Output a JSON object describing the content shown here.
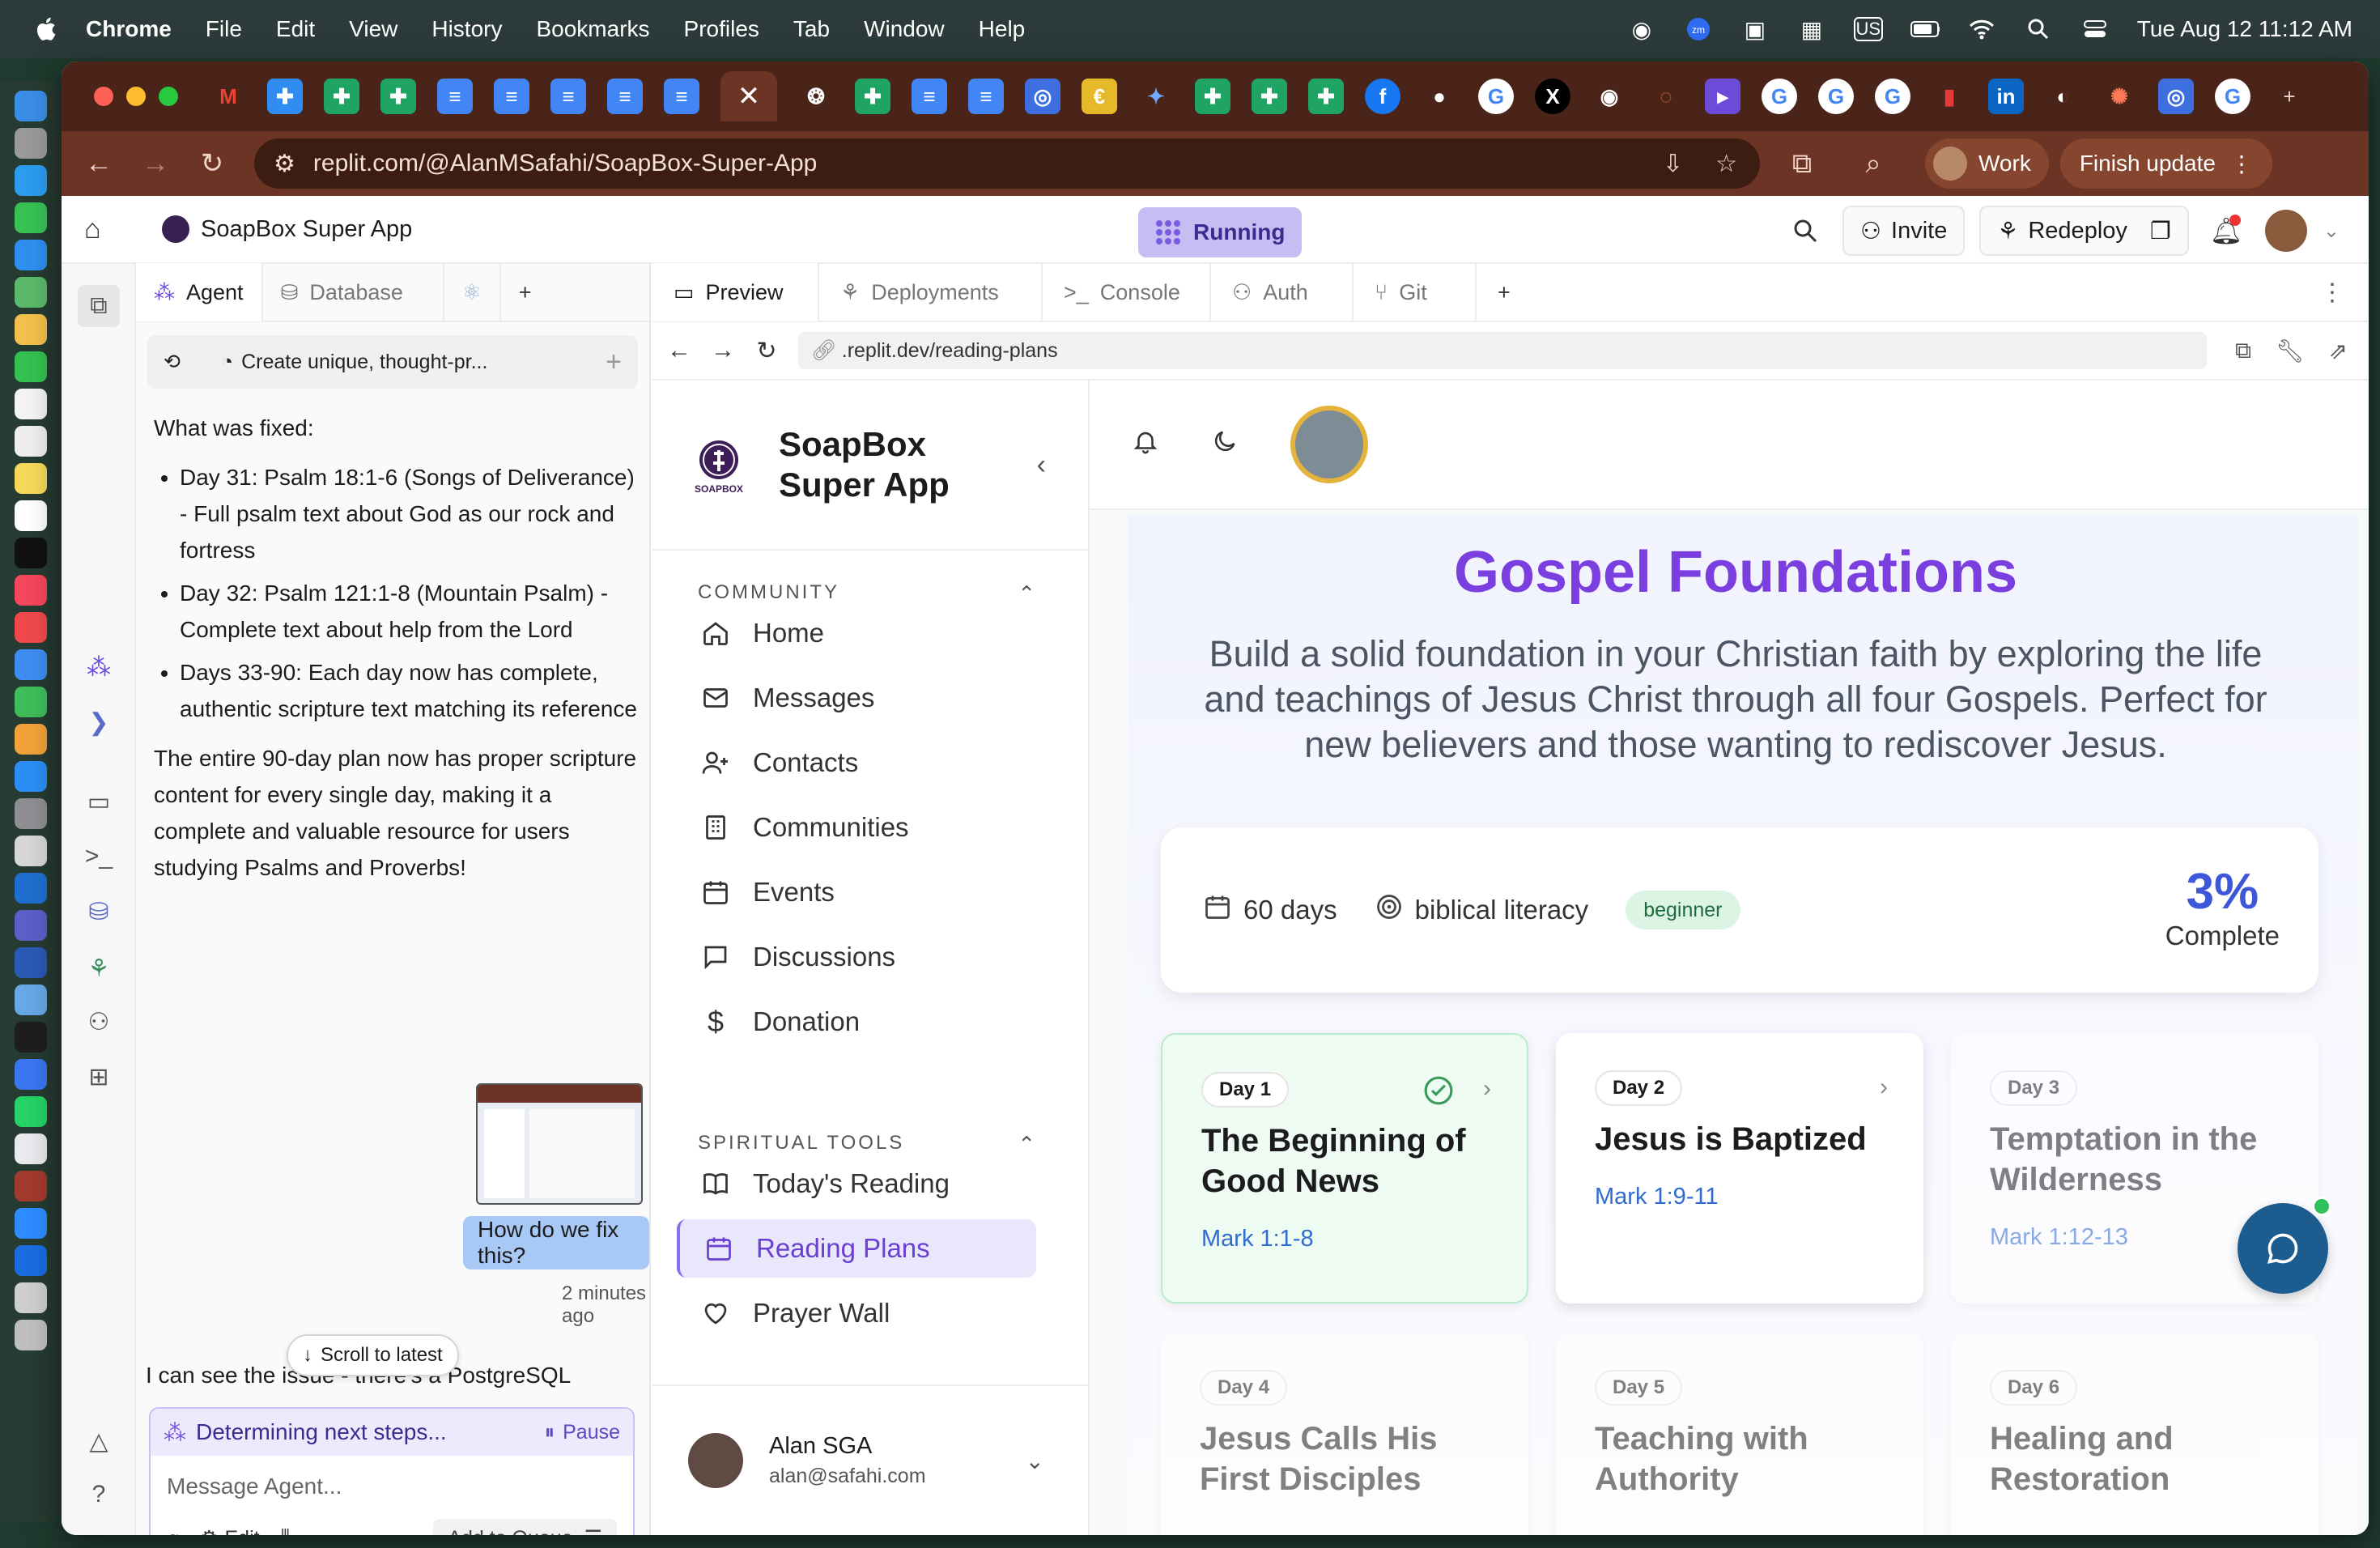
{
  "menubar": {
    "app": "Chrome",
    "items": [
      "File",
      "Edit",
      "View",
      "History",
      "Bookmarks",
      "Profiles",
      "Tab",
      "Window",
      "Help"
    ],
    "kbd": "US",
    "clock": "Tue Aug 12  11:12 AM"
  },
  "browser": {
    "url": "replit.com/@AlanMSafahi/SoapBox-Super-App",
    "profile": "Work",
    "finish_update": "Finish update",
    "active_tab_close": "✕"
  },
  "replit": {
    "app_title": "SoapBox Super App",
    "status": "Running",
    "invite": "Invite",
    "redeploy": "Redeploy"
  },
  "agent": {
    "tabs": [
      "Agent",
      "Database"
    ],
    "thread_title": "Create unique, thought-pr...",
    "heading": "What was fixed:",
    "bullets": [
      "Day 31: Psalm 18:1-6 (Songs of Deliverance) - Full psalm text about God as our rock and fortress",
      "Day 32: Psalm 121:1-8 (Mountain Psalm) - Complete text about help from the Lord",
      "Days 33-90: Each day now has complete, authentic scripture text matching its reference"
    ],
    "summary": "The entire 90-day plan now has proper scripture content for every single day, making it a complete and valuable resource for users studying Psalms and Proverbs!",
    "user_message": "How do we fix this?",
    "timestamp": "2 minutes ago",
    "last_message": "I can see the issue - there's a PostgreSQL",
    "scroll_latest": "Scroll to latest",
    "status_text": "Determining next steps...",
    "pause": "Pause",
    "placeholder": "Message Agent...",
    "edit": "Edit",
    "queue": "Add to Queue"
  },
  "preview": {
    "tabs": [
      "Preview",
      "Deployments",
      "Console",
      "Auth",
      "Git"
    ],
    "address": ".replit.dev/reading-plans"
  },
  "app": {
    "brand_line1": "SoapBox",
    "brand_line2": "Super App",
    "logo_text": "SOAPBOX",
    "community_label": "COMMUNITY",
    "community": [
      "Home",
      "Messages",
      "Contacts",
      "Communities",
      "Events",
      "Discussions",
      "Donation"
    ],
    "tools_label": "SPIRITUAL TOOLS",
    "tools": [
      "Today's Reading",
      "Reading Plans",
      "Prayer Wall"
    ],
    "user_name": "Alan SGA",
    "user_email": "alan@safahi.com"
  },
  "plan": {
    "title": "Gospel Foundations",
    "description": "Build a solid foundation in your Christian faith by exploring the life and teachings of Jesus Christ through all four Gospels. Perfect for new believers and those wanting to rediscover Jesus.",
    "duration": "60 days",
    "category": "biblical literacy",
    "level": "beginner",
    "progress_pct": "3%",
    "progress_label": "Complete",
    "days": [
      {
        "label": "Day 1",
        "title": "The Beginning of Good News",
        "ref": "Mark 1:1-8"
      },
      {
        "label": "Day 2",
        "title": "Jesus is Baptized",
        "ref": "Mark 1:9-11"
      },
      {
        "label": "Day 3",
        "title": "Temptation in the Wilderness",
        "ref": "Mark 1:12-13"
      },
      {
        "label": "Day 4",
        "title": "Jesus Calls His First Disciples",
        "ref": ""
      },
      {
        "label": "Day 5",
        "title": "Teaching with Authority",
        "ref": ""
      },
      {
        "label": "Day 6",
        "title": "Healing and Restoration",
        "ref": ""
      }
    ]
  }
}
